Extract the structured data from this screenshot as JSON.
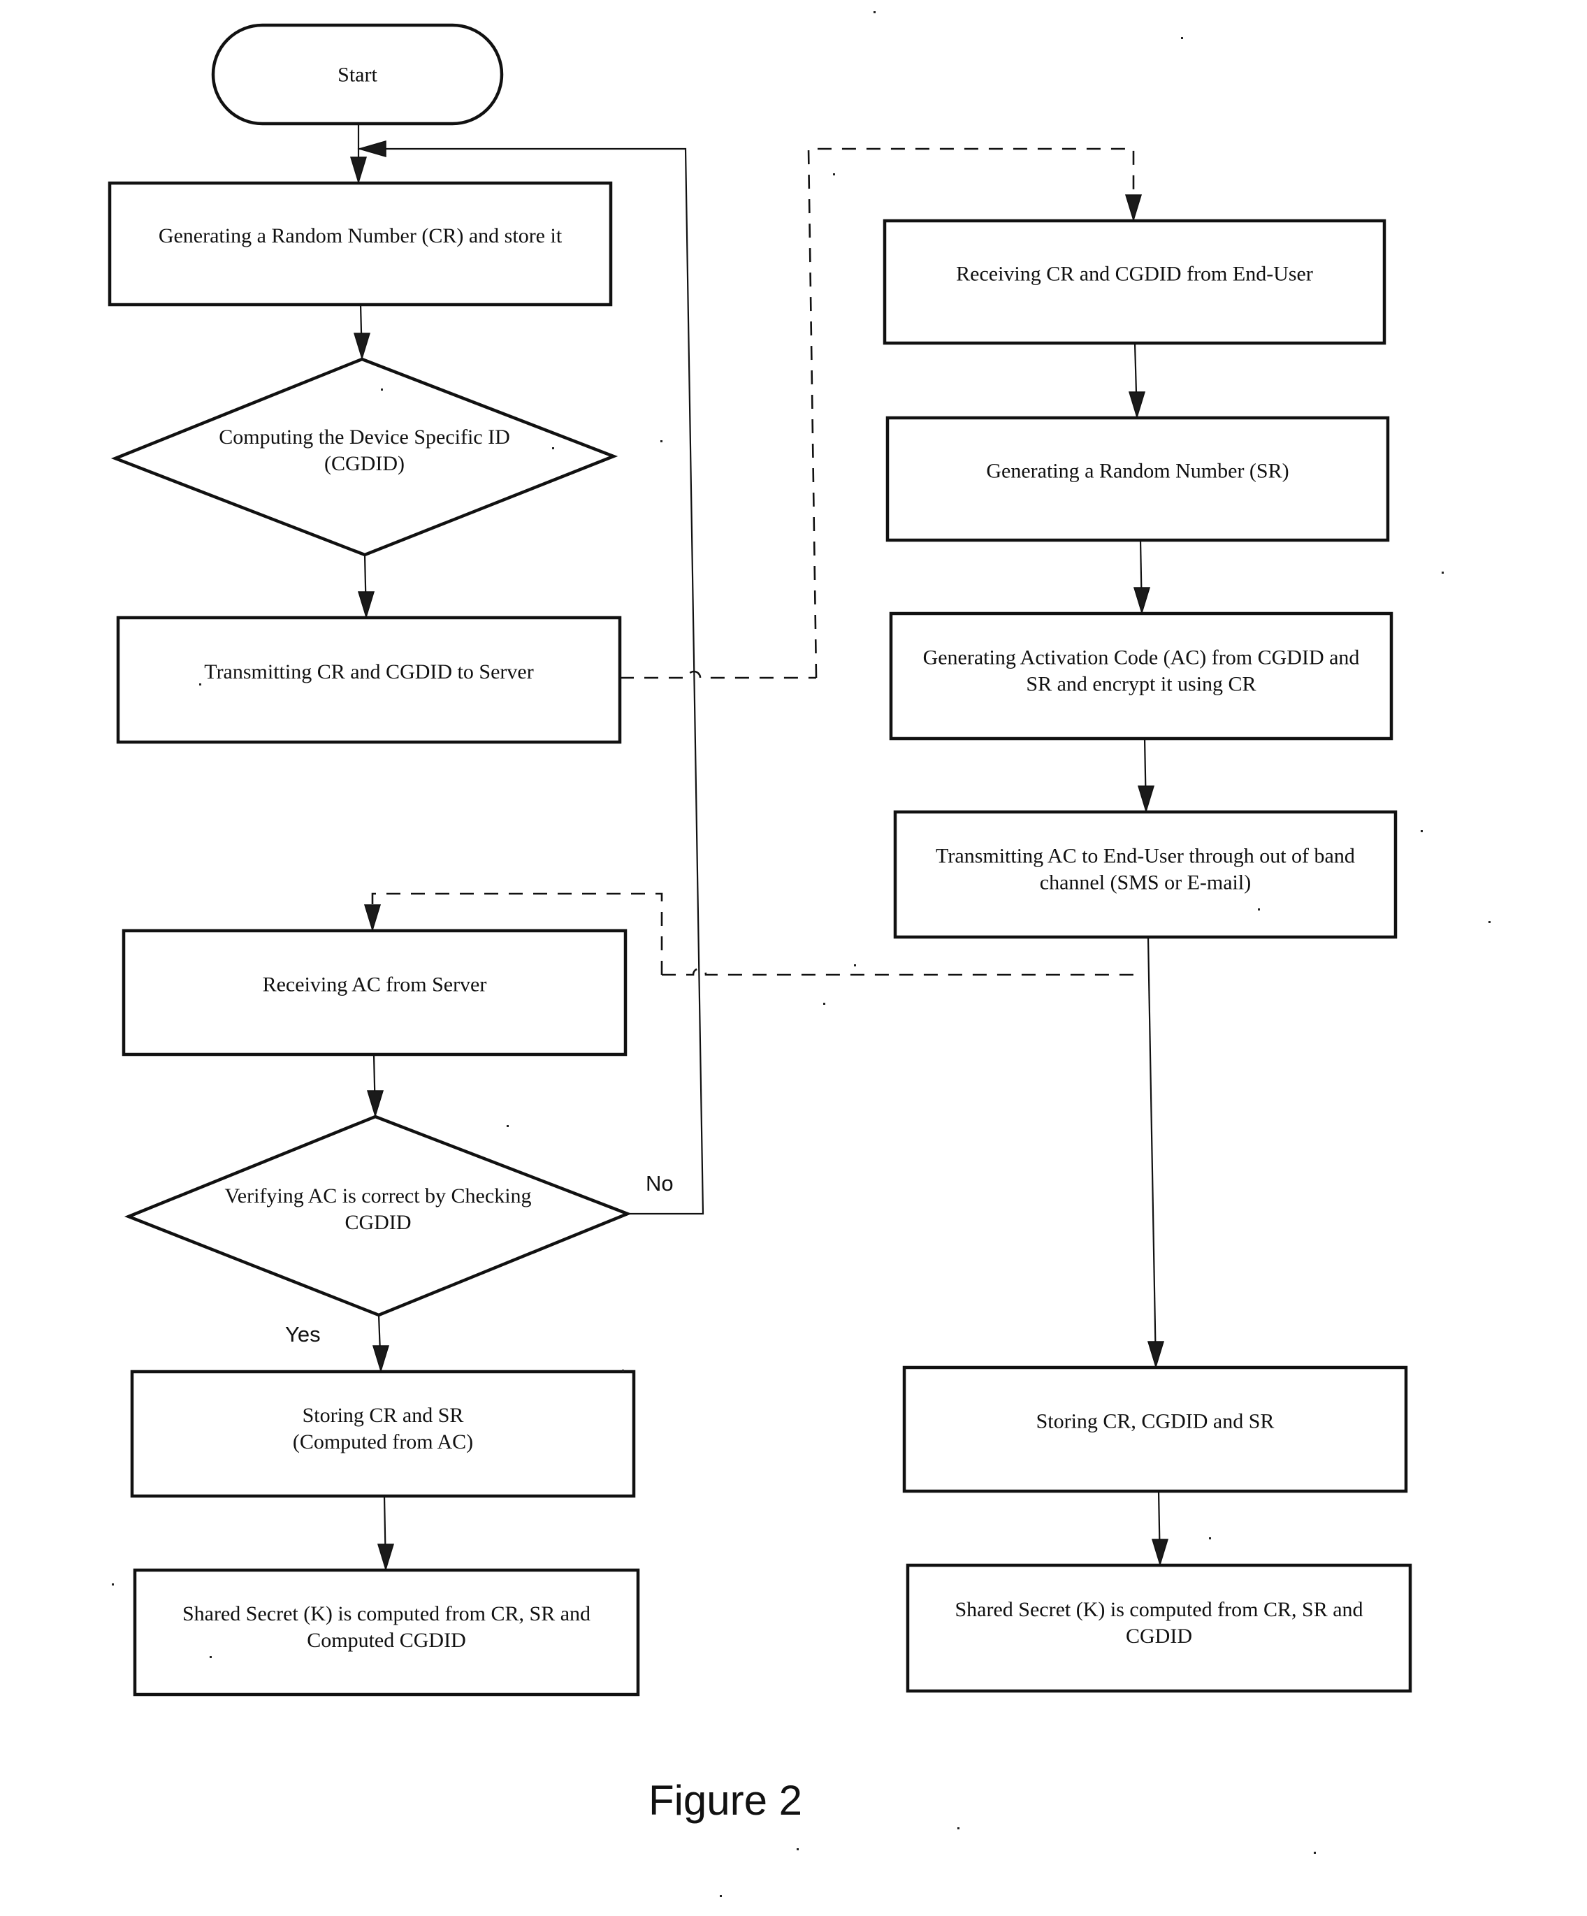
{
  "figure": {
    "caption": "Figure 2"
  },
  "nodes": {
    "start": {
      "type": "terminator",
      "lines": [
        "Start"
      ]
    },
    "gen_cr": {
      "type": "process",
      "lines": [
        "Generating a Random Number (CR) and store it"
      ]
    },
    "compute_cgdid": {
      "type": "decision",
      "lines": [
        "Computing the Device Specific ID",
        "(CGDID)"
      ]
    },
    "transmit_cr": {
      "type": "process",
      "lines": [
        "Transmitting CR and CGDID to Server"
      ]
    },
    "receive_ac": {
      "type": "process",
      "lines": [
        "Receiving AC from Server"
      ]
    },
    "verify_ac": {
      "type": "decision",
      "lines": [
        "Verifying AC is correct by Checking",
        "CGDID"
      ]
    },
    "store_cr_sr": {
      "type": "process",
      "lines": [
        "Storing CR and SR",
        "(Computed from AC)"
      ]
    },
    "shared_client": {
      "type": "process",
      "lines": [
        "Shared Secret (K) is computed from CR, SR and",
        "Computed CGDID"
      ]
    },
    "receive_cr": {
      "type": "process",
      "lines": [
        "Receiving CR and CGDID from End-User"
      ]
    },
    "gen_sr": {
      "type": "process",
      "lines": [
        "Generating a Random Number (SR)"
      ]
    },
    "gen_ac": {
      "type": "process",
      "lines": [
        "Generating Activation Code (AC) from CGDID and",
        "SR and encrypt it using CR"
      ]
    },
    "transmit_ac": {
      "type": "process",
      "lines": [
        "Transmitting AC to End-User through out of band",
        "channel (SMS or E-mail)"
      ]
    },
    "store_server": {
      "type": "process",
      "lines": [
        "Storing CR, CGDID and SR"
      ]
    },
    "shared_server": {
      "type": "process",
      "lines": [
        "Shared Secret (K) is computed from CR, SR and",
        "CGDID"
      ]
    }
  },
  "edge_labels": {
    "no": "No",
    "yes": "Yes"
  },
  "edges": [
    {
      "from": "start",
      "to": "gen_cr",
      "style": "solid"
    },
    {
      "from": "gen_cr",
      "to": "compute_cgdid",
      "style": "solid"
    },
    {
      "from": "compute_cgdid",
      "to": "transmit_cr",
      "style": "solid"
    },
    {
      "from": "transmit_cr",
      "to": "receive_cr",
      "style": "dashed"
    },
    {
      "from": "receive_cr",
      "to": "gen_sr",
      "style": "solid"
    },
    {
      "from": "gen_sr",
      "to": "gen_ac",
      "style": "solid"
    },
    {
      "from": "gen_ac",
      "to": "transmit_ac",
      "style": "solid"
    },
    {
      "from": "transmit_ac",
      "to": "receive_ac",
      "style": "dashed"
    },
    {
      "from": "transmit_ac",
      "to": "store_server",
      "style": "solid"
    },
    {
      "from": "receive_ac",
      "to": "verify_ac",
      "style": "solid"
    },
    {
      "from": "verify_ac",
      "to": "gen_cr",
      "style": "solid",
      "label": "No"
    },
    {
      "from": "verify_ac",
      "to": "store_cr_sr",
      "style": "solid",
      "label": "Yes"
    },
    {
      "from": "store_cr_sr",
      "to": "shared_client",
      "style": "solid"
    },
    {
      "from": "store_server",
      "to": "shared_server",
      "style": "solid"
    }
  ]
}
